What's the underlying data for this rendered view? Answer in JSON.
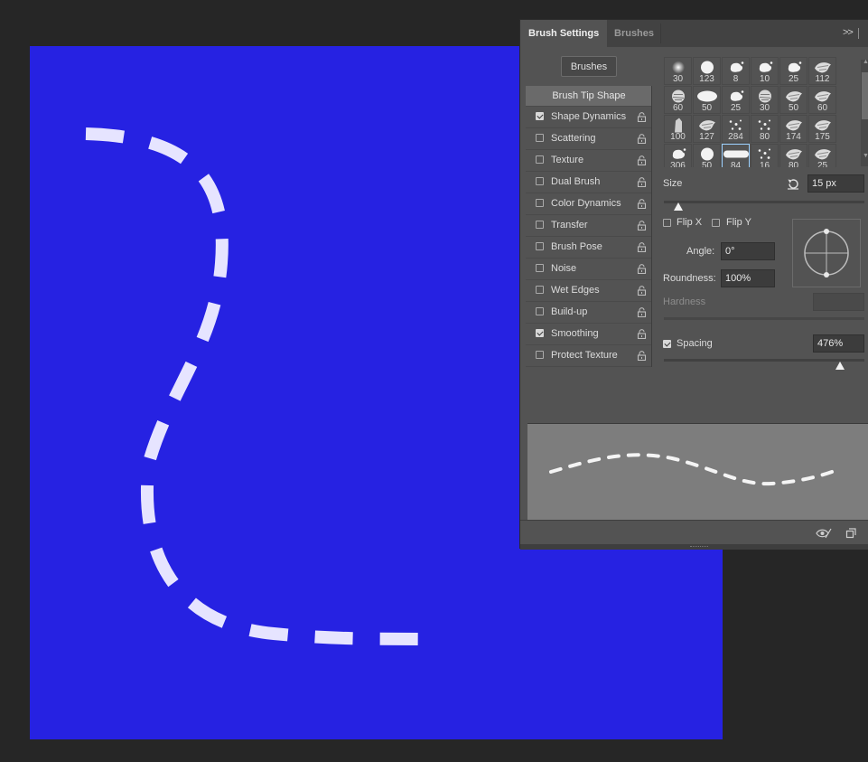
{
  "panel": {
    "tabs": [
      {
        "label": "Brush Settings",
        "active": true
      },
      {
        "label": "Brushes",
        "active": false
      }
    ],
    "menu_glyph": ">>",
    "brushes_button": "Brushes"
  },
  "options": [
    {
      "label": "Brush Tip Shape",
      "header": true
    },
    {
      "label": "Shape Dynamics",
      "checked": true,
      "lock": true
    },
    {
      "label": "Scattering",
      "checked": false,
      "lock": true
    },
    {
      "label": "Texture",
      "checked": false,
      "lock": true
    },
    {
      "label": "Dual Brush",
      "checked": false,
      "lock": true
    },
    {
      "label": "Color Dynamics",
      "checked": false,
      "lock": true
    },
    {
      "label": "Transfer",
      "checked": false,
      "lock": true
    },
    {
      "label": "Brush Pose",
      "checked": false,
      "lock": true
    },
    {
      "label": "Noise",
      "checked": false,
      "lock": true
    },
    {
      "label": "Wet Edges",
      "checked": false,
      "lock": true
    },
    {
      "label": "Build-up",
      "checked": false,
      "lock": true
    },
    {
      "label": "Smoothing",
      "checked": true,
      "lock": true
    },
    {
      "label": "Protect Texture",
      "checked": false,
      "lock": true
    }
  ],
  "brush_tips": [
    {
      "size": "30",
      "shape": "soft-round"
    },
    {
      "size": "123",
      "shape": "hard-round"
    },
    {
      "size": "8",
      "shape": "splat"
    },
    {
      "size": "10",
      "shape": "splat"
    },
    {
      "size": "25",
      "shape": "splat"
    },
    {
      "size": "112",
      "shape": "spray"
    },
    {
      "size": "60",
      "shape": "textured"
    },
    {
      "size": "50",
      "shape": "oval"
    },
    {
      "size": "25",
      "shape": "splat"
    },
    {
      "size": "30",
      "shape": "textured"
    },
    {
      "size": "50",
      "shape": "spray"
    },
    {
      "size": "60",
      "shape": "spray"
    },
    {
      "size": "100",
      "shape": "chalk"
    },
    {
      "size": "127",
      "shape": "spray"
    },
    {
      "size": "284",
      "shape": "dots"
    },
    {
      "size": "80",
      "shape": "dots"
    },
    {
      "size": "174",
      "shape": "spray"
    },
    {
      "size": "175",
      "shape": "spray"
    },
    {
      "size": "306",
      "shape": "splat"
    },
    {
      "size": "50",
      "shape": "hard-round"
    },
    {
      "size": "84",
      "shape": "capsule",
      "selected": true
    },
    {
      "size": "16",
      "shape": "dots"
    },
    {
      "size": "80",
      "shape": "spray"
    },
    {
      "size": "25",
      "shape": "spray"
    }
  ],
  "tip_settings": {
    "size_label": "Size",
    "size_value": "15 px",
    "size_slider": 0.07,
    "flip_x_label": "Flip X",
    "flip_y_label": "Flip Y",
    "angle_label": "Angle:",
    "angle_value": "0°",
    "roundness_label": "Roundness:",
    "roundness_value": "100%",
    "hardness_label": "Hardness",
    "hardness_value": "",
    "spacing_label": "Spacing",
    "spacing_checked": true,
    "spacing_value": "476%",
    "spacing_slider": 0.88
  },
  "colors": {
    "canvas": "#2622e2",
    "dash": "#e6e4ff",
    "panel": "#535353",
    "selected_outline": "#9bd0ff"
  },
  "icons": {
    "reset": "reset-icon",
    "lock": "lock-icon",
    "eye": "visibility-icon",
    "new_preset": "new-preset-icon"
  }
}
